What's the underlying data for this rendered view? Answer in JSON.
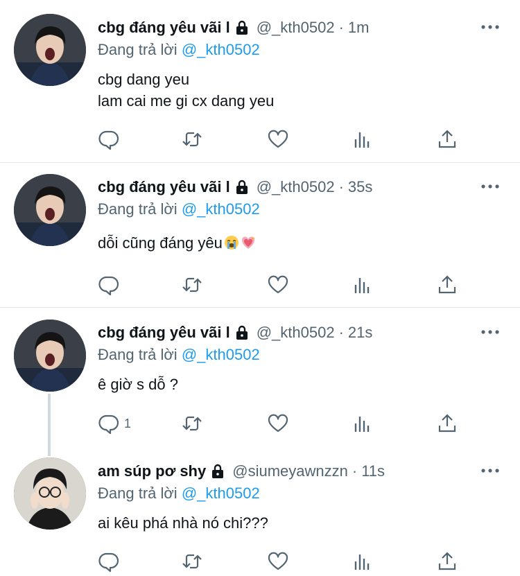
{
  "tweets": [
    {
      "name": "cbg đáng yêu vãi l",
      "handle": "@_kth0502",
      "separator": "·",
      "time": "1m",
      "reply_prefix": "Đang trả lời",
      "reply_to": "@_kth0502",
      "text_lines": [
        "cbg dang yeu",
        "lam cai me gi cx dang yeu"
      ],
      "reply_count": ""
    },
    {
      "name": "cbg đáng yêu vãi l",
      "handle": "@_kth0502",
      "separator": "·",
      "time": "35s",
      "reply_prefix": "Đang trả lời",
      "reply_to": "@_kth0502",
      "text_lines": [
        "dỗi cũng đáng yêu"
      ],
      "emojis": [
        "loudly-crying-face",
        "sparkling-heart"
      ],
      "reply_count": ""
    },
    {
      "name": "cbg đáng yêu vãi l",
      "handle": "@_kth0502",
      "separator": "·",
      "time": "21s",
      "reply_prefix": "Đang trả lời",
      "reply_to": "@_kth0502",
      "text_lines": [
        "ê giờ s dỗ ?"
      ],
      "reply_count": "1"
    },
    {
      "name": "am súp pơ shy",
      "handle": "@siumeyawnzzn",
      "separator": "·",
      "time": "11s",
      "reply_prefix": "Đang trả lời",
      "reply_to": "@_kth0502",
      "text_lines": [
        "ai kêu phá nhà nó chi???"
      ],
      "reply_count": ""
    }
  ],
  "icons": {
    "lock": "lock-icon",
    "more": "more-horizontal-icon",
    "reply": "reply-icon",
    "retweet": "retweet-icon",
    "like": "heart-icon",
    "views": "views-icon",
    "share": "share-icon"
  },
  "colors": {
    "text": "#0f1419",
    "muted": "#536471",
    "link": "#1d9bf0",
    "divider": "#e1e6ea",
    "thread_line": "#cfd9de"
  }
}
